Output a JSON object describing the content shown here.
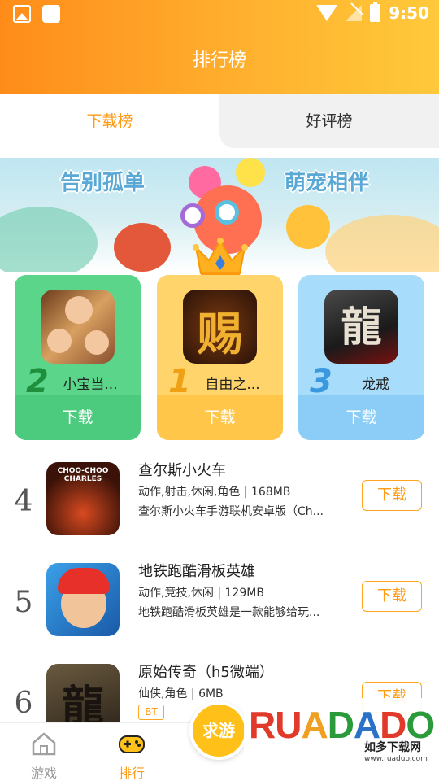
{
  "status": {
    "time": "9:50"
  },
  "header": {
    "title": "排行榜"
  },
  "tabs": [
    {
      "label": "下载榜"
    },
    {
      "label": "好评榜"
    }
  ],
  "banner": {
    "left_text": "告别孤单",
    "right_text": "萌宠相伴"
  },
  "top3": [
    {
      "rank": "2",
      "name": "小宝当...",
      "download": "下载"
    },
    {
      "rank": "1",
      "name": "自由之...",
      "download": "下载"
    },
    {
      "rank": "3",
      "name": "龙戒",
      "download": "下载"
    }
  ],
  "list": [
    {
      "rank": "4",
      "name": "查尔斯小火车",
      "tags": "动作,射击,休闲,角色 | 168MB",
      "desc": "查尔斯小火车手游联机安卓版（Ch...",
      "download": "下载",
      "icon_text": "CHOO-CHOO CHARLES"
    },
    {
      "rank": "5",
      "name": "地铁跑酷滑板英雄",
      "tags": "动作,竞技,休闲 | 129MB",
      "desc": "地铁跑酷滑板英雄是一款能够给玩...",
      "download": "下载"
    },
    {
      "rank": "6",
      "name": "原始传奇（h5微端）",
      "tags": "仙侠,角色 | 6MB",
      "badge": "BT",
      "download": "下载",
      "icon_text": "龍"
    }
  ],
  "nav": {
    "game": "游戏",
    "rank": "排行",
    "fab": "求游"
  },
  "watermark": {
    "brand": "RUANDADO",
    "sub": "如多下载网",
    "url": "www.ruaduo.com"
  },
  "colors": {
    "accent": "#ff9a14",
    "green": "#4ccb7e",
    "gold": "#ffc64a",
    "blue": "#8ccdf7"
  }
}
